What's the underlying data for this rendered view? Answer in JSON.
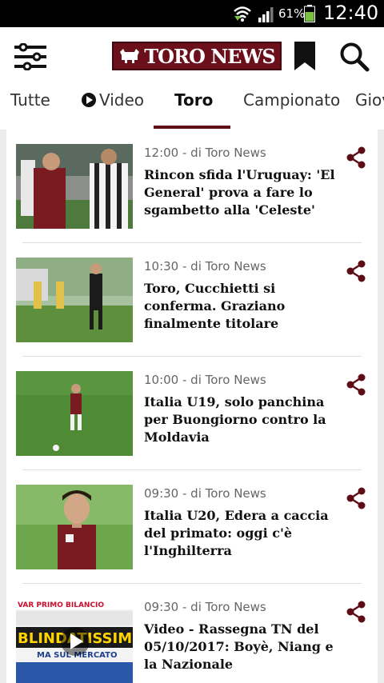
{
  "status_bar": {
    "battery_text": "61%",
    "time": "12:40",
    "icons": [
      "wifi-icon",
      "signal-icon",
      "battery-icon"
    ]
  },
  "header": {
    "logo_text": "TORO NEWS",
    "brand_color": "#6b0f1a",
    "icons": [
      "menu-icon",
      "bookmark-icon",
      "search-icon"
    ]
  },
  "tabs": [
    {
      "label": "Tutte"
    },
    {
      "label": "Video"
    },
    {
      "label": "Toro",
      "active": true
    },
    {
      "label": "Campionato"
    },
    {
      "label": "Giov"
    }
  ],
  "articles": [
    {
      "meta": "12:00 - di Toro News",
      "title": "Rincon sfida l'Uruguay: 'El General' prova a fare lo sgambetto alla 'Celeste'"
    },
    {
      "meta": "10:30 - di Toro News",
      "title": "Toro, Cucchietti si conferma. Graziano finalmente titolare"
    },
    {
      "meta": "10:00 - di Toro News",
      "title": "Italia U19, solo panchina per Buongiorno contro la Moldavia"
    },
    {
      "meta": "09:30 - di Toro News",
      "title": "Italia U20, Edera a caccia del primato: oggi c'è l'Inghilterra"
    },
    {
      "meta": "09:30 - di Toro News",
      "title": "Video - Rassegna TN del 05/10/2017: Boyè, Niang e la Nazionale"
    }
  ],
  "thumb_texts": {
    "press_header": "VAR PRIMO BILANCIO",
    "press_headline": "BLINDATISSIMI",
    "press_sub": "MA SUL MERCATO"
  }
}
